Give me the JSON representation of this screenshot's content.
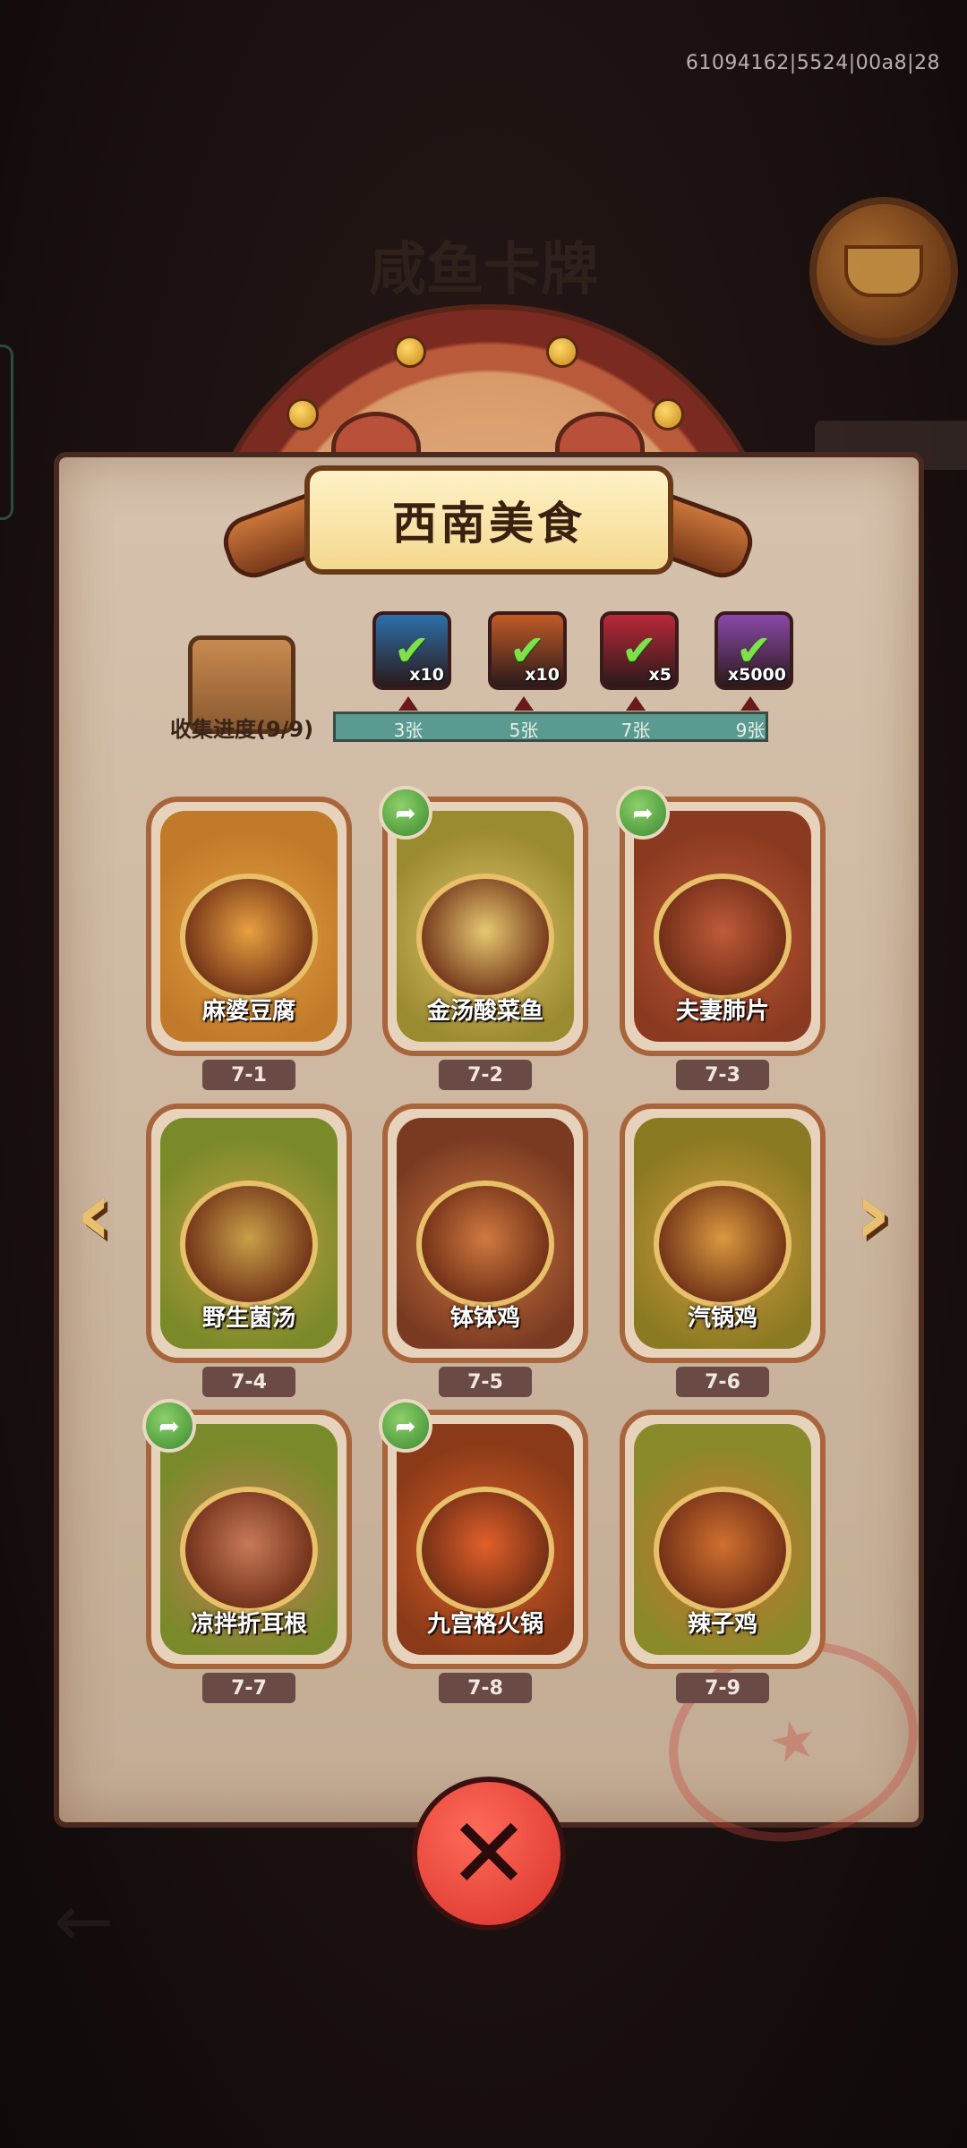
{
  "debug_id": "61094162|5524|00a8|28",
  "background_title": "咸鱼卡牌",
  "panel": {
    "title": "西南美食",
    "progress_label": "收集进度(9/9)"
  },
  "milestones": [
    {
      "label": "3张",
      "reward_icon": "treasure-chest-icon",
      "qty": "x10",
      "color": "#2d6fa8",
      "claimed": true
    },
    {
      "label": "5张",
      "reward_icon": "ticket-icon",
      "qty": "x10",
      "color": "#c05a28",
      "claimed": true
    },
    {
      "label": "7张",
      "reward_icon": "gem-orb-icon",
      "qty": "x5",
      "color": "#b82838",
      "claimed": true
    },
    {
      "label": "9张",
      "reward_icon": "crystal-icon",
      "qty": "x5000",
      "color": "#8a48a8",
      "claimed": true
    }
  ],
  "cards": [
    {
      "name": "麻婆豆腐",
      "num": "7-1",
      "shared": false,
      "tone": "#c07a2a",
      "dish": "#e8a040"
    },
    {
      "name": "金汤酸菜鱼",
      "num": "7-2",
      "shared": true,
      "tone": "#9a8a30",
      "dish": "#e6c870"
    },
    {
      "name": "夫妻肺片",
      "num": "7-3",
      "shared": true,
      "tone": "#8a3a20",
      "dish": "#c05a3a"
    },
    {
      "name": "野生菌汤",
      "num": "7-4",
      "shared": false,
      "tone": "#7a8a28",
      "dish": "#c8a048"
    },
    {
      "name": "钵钵鸡",
      "num": "7-5",
      "shared": false,
      "tone": "#7a3a22",
      "dish": "#d07a40"
    },
    {
      "name": "汽锅鸡",
      "num": "7-6",
      "shared": false,
      "tone": "#8a7a22",
      "dish": "#d89a40"
    },
    {
      "name": "凉拌折耳根",
      "num": "7-7",
      "shared": true,
      "tone": "#7a8a2a",
      "dish": "#c87a58"
    },
    {
      "name": "九宫格火锅",
      "num": "7-8",
      "shared": true,
      "tone": "#8a3a18",
      "dish": "#e0602a"
    },
    {
      "name": "辣子鸡",
      "num": "7-9",
      "shared": false,
      "tone": "#8a8a2a",
      "dish": "#d07030"
    }
  ],
  "colors": {
    "paper": "#cdb7a0",
    "card_border": "#a8643a",
    "progress_fill": "#5a9a90",
    "close_button": "#e2403a"
  }
}
